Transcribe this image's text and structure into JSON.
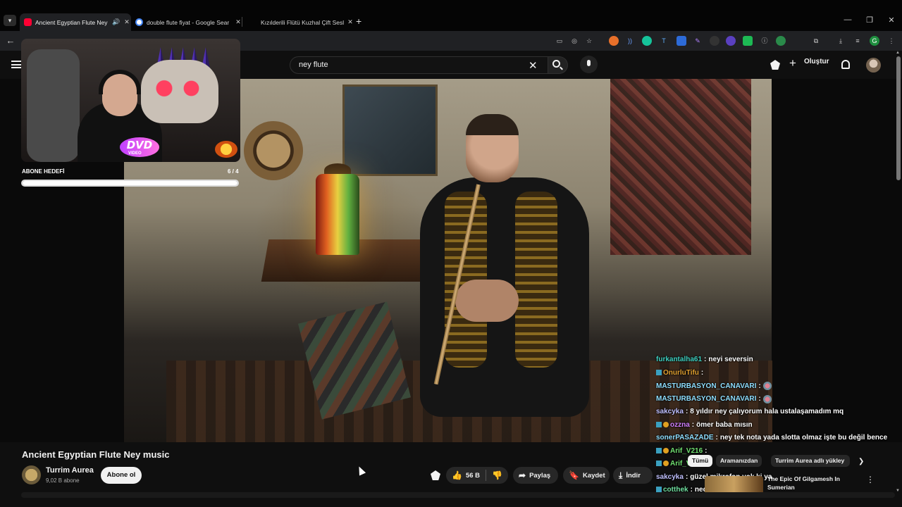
{
  "browser": {
    "tabs": [
      {
        "title": "Ancient Egyptian Flute Ney",
        "icon": "youtube-favicon",
        "audio": true
      },
      {
        "title": "double flute fiyat - Google Sear",
        "icon": "google-favicon"
      },
      {
        "title": "Kızılderili Flütü Kuzhal Çift Sesli",
        "icon": "page-favicon"
      }
    ],
    "new_tab_glyph": "+",
    "window_controls": [
      "—",
      "❐",
      "✕"
    ]
  },
  "youtube_header": {
    "search_value": "ney flute",
    "create_label": "Oluştur"
  },
  "stream_overlay": {
    "goal_label": "ABONE HEDEFİ",
    "goal_count": "6 / 4",
    "goal_progress": 1.0,
    "dvd_logo": "DVD",
    "dvd_sub": "VIDEO"
  },
  "chat": [
    {
      "user": "furkantalha61",
      "user_color": "#3fd0c0",
      "message": "neyi seversin",
      "emote": false,
      "badge": ""
    },
    {
      "user": "OnurluTifu",
      "user_color": "#e0a030",
      "message": "",
      "emote": false,
      "badge": "mod"
    },
    {
      "user": "MASTURBASYON_CANAVARI",
      "user_color": "#8fdfff",
      "message": "",
      "emote": true,
      "badge": ""
    },
    {
      "user": "MASTURBASYON_CANAVARI",
      "user_color": "#8fdfff",
      "message": "",
      "emote": true,
      "badge": ""
    },
    {
      "user": "sakcyka",
      "user_color": "#c0c0ff",
      "message": "8 yıldır ney çalıyorum hala ustalaşamadım mq",
      "emote": false,
      "badge": ""
    },
    {
      "user": "ozzna",
      "user_color": "#d080ff",
      "message": "ömer baba mısın",
      "emote": false,
      "badge": "mod-sub"
    },
    {
      "user": "sonerPASAZADE",
      "user_color": "#8fdfff",
      "message": "ney tek nota yada slotta olmaz işte bu değil bence",
      "emote": false,
      "badge": ""
    },
    {
      "user": "Arif_V216",
      "user_color": "#70e070",
      "message": "",
      "emote": false,
      "badge": "mod-sub"
    },
    {
      "user": "Arif_V216",
      "user_color": "#70e070",
      "message": "",
      "emote": false,
      "badge": "mod-sub"
    },
    {
      "user": "sakcyka",
      "user_color": "#c0c0ff",
      "message": "güzel mikrofon yok ki ya",
      "emote": false,
      "badge": ""
    },
    {
      "user": "cotthek",
      "user_color": "#70e0a0",
      "message": "neden",
      "emote": false,
      "badge": "mod"
    }
  ],
  "video": {
    "title": "Ancient Egyptian Flute Ney music",
    "channel_name": "Turrim Aurea",
    "channel_subs": "9,02 B abone",
    "subscribe_label": "Abone ol",
    "like_count": "56 B",
    "share_label": "Paylaş",
    "save_label": "Kaydet",
    "download_label": "İndir"
  },
  "recommendations": {
    "chips": [
      "Tümü",
      "Aramanızdan",
      "Turrim Aurea adlı yükley"
    ],
    "items": [
      {
        "title": "The Epic Of Gilgamesh In Sumerian"
      }
    ]
  }
}
